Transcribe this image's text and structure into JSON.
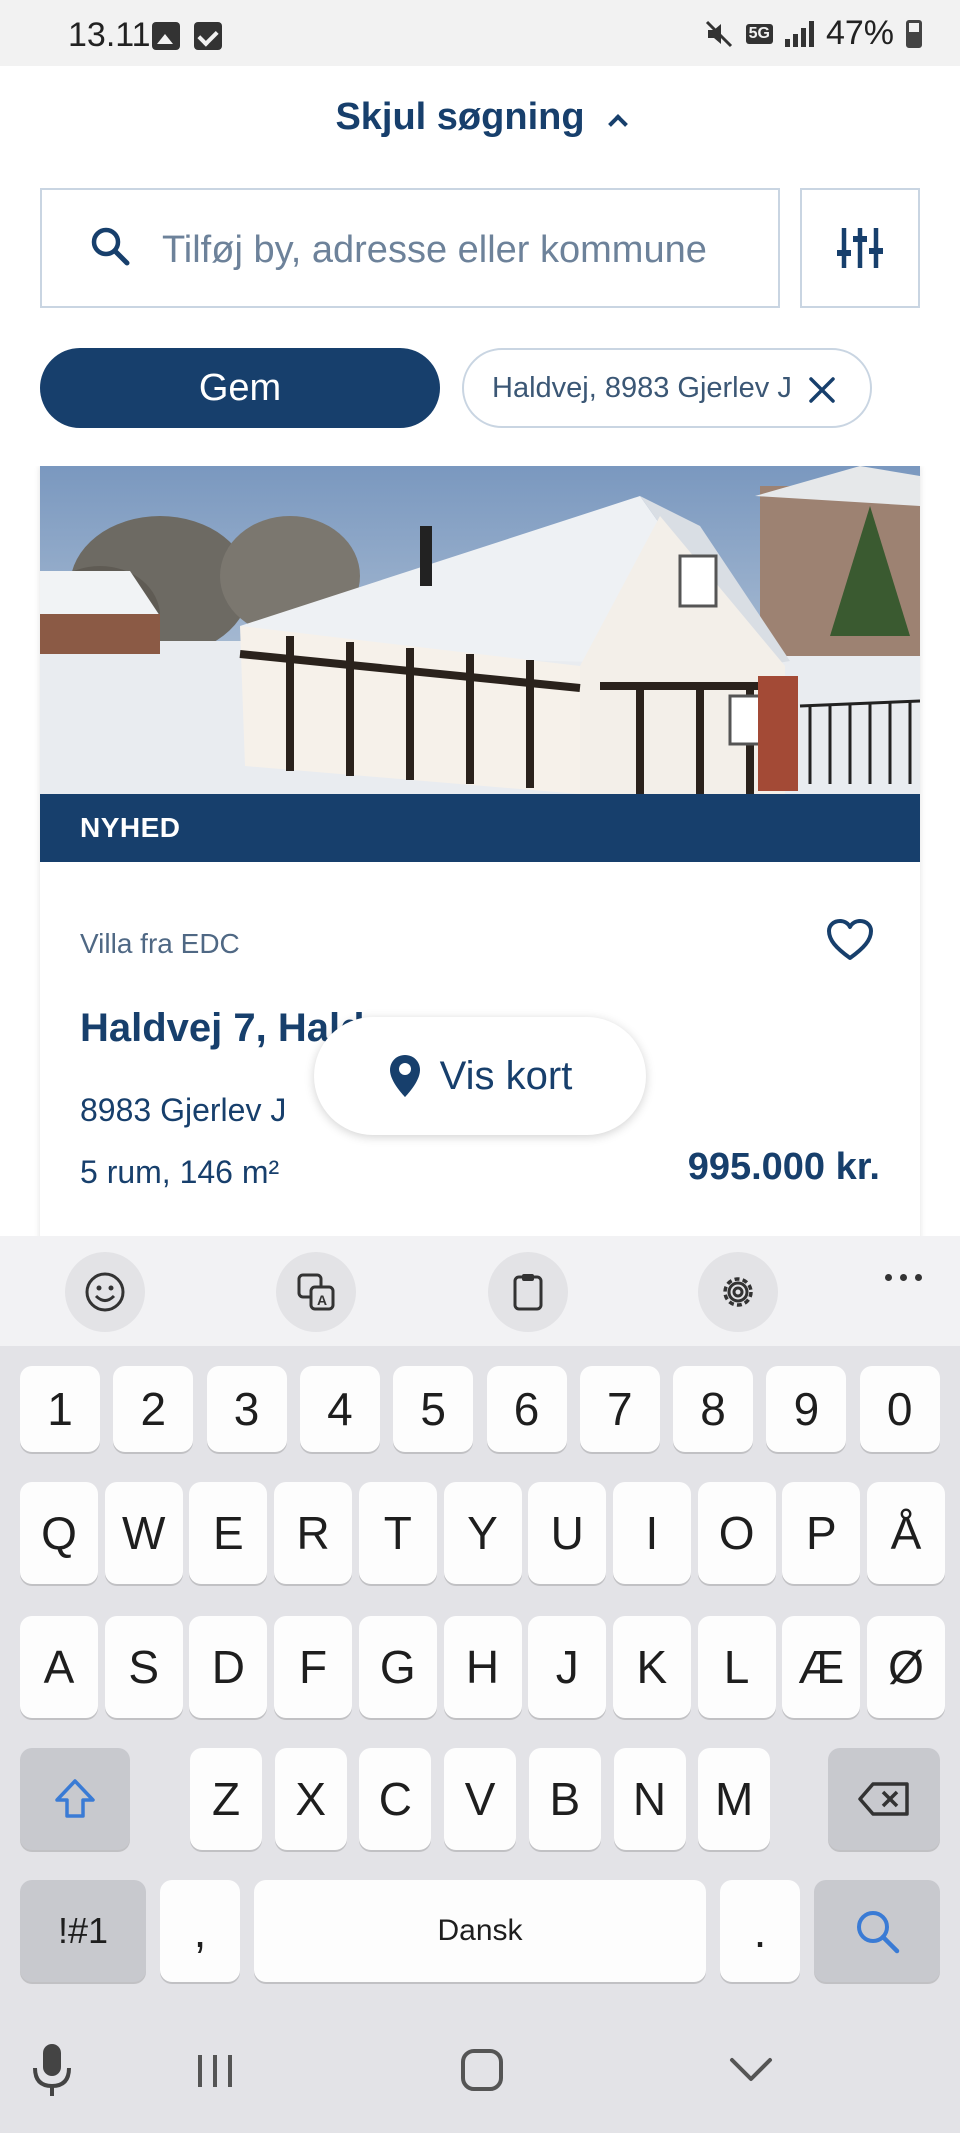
{
  "status_bar": {
    "time": "13.11",
    "network": "5G",
    "battery": "47%"
  },
  "header": {
    "toggle_label": "Skjul søgning",
    "search_placeholder": "Tilføj by, adresse eller kommune",
    "save_label": "Gem",
    "filter_chip_label": "Haldvej, 8983 Gjerlev J"
  },
  "listing": {
    "badge": "NYHED",
    "property_type": "Villa fra EDC",
    "address": "Haldvej 7, Hald",
    "zip_city": "8983 Gjerlev J",
    "rooms_area": "5 rum, 146 m²",
    "price": "995.000 kr.",
    "favorited": false
  },
  "map_button": {
    "label": "Vis kort"
  },
  "keyboard": {
    "toolbar_icons": [
      "emoji-icon",
      "translate-icon",
      "clipboard-icon",
      "settings-icon",
      "more-icon"
    ],
    "row_numbers": [
      "1",
      "2",
      "3",
      "4",
      "5",
      "6",
      "7",
      "8",
      "9",
      "0"
    ],
    "row_1": [
      "Q",
      "W",
      "E",
      "R",
      "T",
      "Y",
      "U",
      "I",
      "O",
      "P",
      "Å"
    ],
    "row_2": [
      "A",
      "S",
      "D",
      "F",
      "G",
      "H",
      "J",
      "K",
      "L",
      "Æ",
      "Ø"
    ],
    "row_3": [
      "Z",
      "X",
      "C",
      "V",
      "B",
      "N",
      "M"
    ],
    "symbols_label": "!#1",
    "comma_label": ",",
    "space_label": "Dansk",
    "period_label": "."
  },
  "colors": {
    "brand": "#173f6c",
    "keyboard_bg": "#e3e3e7",
    "accent_blue": "#3a7bd5"
  }
}
